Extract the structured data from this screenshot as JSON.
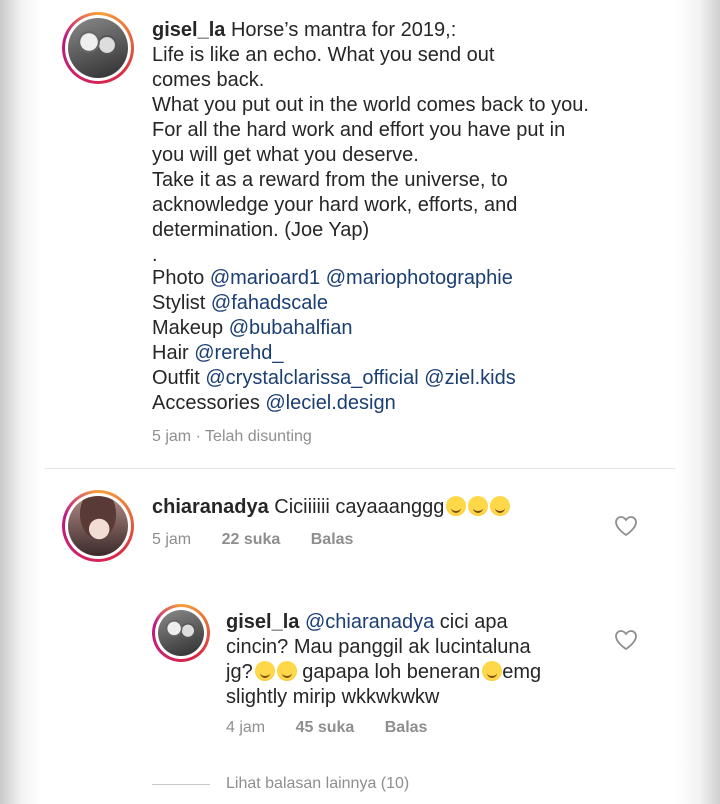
{
  "post": {
    "username": "gisel_la",
    "caption_first": "Horse’s mantra for 2019,:",
    "caption_lines": [
      "Life is like an echo. What you send out",
      "comes back.",
      "What you put out in the world comes back to you.",
      "For all the hard work and effort you have put in",
      "you will get what you deserve.",
      "Take it as a reward from the universe, to",
      "acknowledge your hard work, efforts, and",
      "determination. (Joe Yap)",
      "."
    ],
    "credits": [
      {
        "label": "Photo",
        "mentions": [
          "@marioard1",
          "@mariophotographie"
        ]
      },
      {
        "label": "Stylist",
        "mentions": [
          "@fahadscale"
        ]
      },
      {
        "label": "Makeup",
        "mentions": [
          "@bubahalfian"
        ]
      },
      {
        "label": "Hair",
        "mentions": [
          "@rerehd_"
        ]
      },
      {
        "label": "Outfit",
        "mentions": [
          "@crystalclarissa_official",
          "@ziel.kids"
        ]
      },
      {
        "label": "Accessories",
        "mentions": [
          "@leciel.design"
        ]
      }
    ],
    "meta": "5 jam · Telah disunting"
  },
  "comment": {
    "username": "chiaranadya",
    "text": "Ciciiiiii cayaaanggg",
    "emoji": [
      "hugging-face",
      "hugging-face",
      "hugging-face"
    ],
    "time": "5 jam",
    "likes": "22 suka",
    "reply_label": "Balas"
  },
  "reply": {
    "username": "gisel_la",
    "mention": "@chiaranadya",
    "line1_rest": "cici apa",
    "line2": "cincin? Mau panggil ak lucintaluna",
    "line3_start": "jg?",
    "line3_mid": "gapapa loh beneran",
    "line3_end": "emg",
    "line4": "slightly mirip wkkwkwkw",
    "time": "4 jam",
    "likes": "45 suka",
    "reply_label": "Balas"
  },
  "view_more": "Lihat balasan lainnya (10)",
  "colors": {
    "mention": "#1b3e73",
    "meta": "#8e8e8e",
    "text": "#262626"
  }
}
